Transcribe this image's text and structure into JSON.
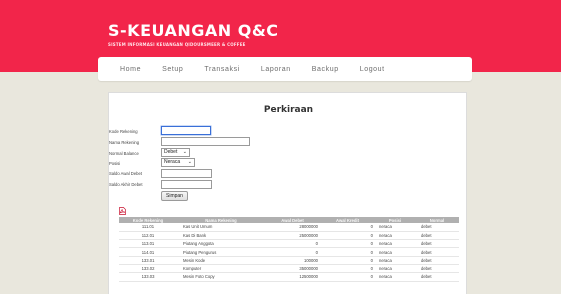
{
  "header": {
    "title": "S-KEUANGAN Q&C",
    "subtitle": "SISTEM INFORMASI KEUANGAN QIDOURSMEER & COFFEE",
    "accent_color": "#f2254a"
  },
  "nav": {
    "items": [
      "Home",
      "Setup",
      "Transaksi",
      "Laporan",
      "Backup",
      "Logout"
    ]
  },
  "page": {
    "title": "Perkiraan"
  },
  "form": {
    "kode_label": "Kode Rekening",
    "kode_value": "",
    "nama_label": "Nama Rekening",
    "nama_value": "",
    "normal_label": "Normal Balance",
    "normal_value": "Debet",
    "posisi_label": "Posisi",
    "posisi_value": "Neraca",
    "saldo_awal_label": "Saldo Awal Debet",
    "saldo_awal_value": "",
    "saldo_akhir_label": "Saldo Akhir Debet",
    "saldo_akhir_value": "",
    "submit_label": "Simpan"
  },
  "export": {
    "icon": "pdf-icon"
  },
  "table": {
    "headers": [
      "Kode Rekening",
      "Nama Rekening",
      "Awal Debet",
      "Awal Kredit",
      "Posisi",
      "Normal"
    ],
    "rows": [
      {
        "kode": "111.01",
        "nama": "Kas Unit Umum",
        "awal_debet": "28000000",
        "awal_kredit": "0",
        "posisi": "neraca",
        "normal": "debet"
      },
      {
        "kode": "112.01",
        "nama": "Kas Di Bank",
        "awal_debet": "25000000",
        "awal_kredit": "0",
        "posisi": "neraca",
        "normal": "debet"
      },
      {
        "kode": "113.01",
        "nama": "Piutang Anggota",
        "awal_debet": "0",
        "awal_kredit": "0",
        "posisi": "neraca",
        "normal": "debet"
      },
      {
        "kode": "114.01",
        "nama": "Piutang Pengurus",
        "awal_debet": "0",
        "awal_kredit": "0",
        "posisi": "neraca",
        "normal": "debet"
      },
      {
        "kode": "133.01",
        "nama": "Mesin Kode",
        "awal_debet": "100000",
        "awal_kredit": "0",
        "posisi": "neraca",
        "normal": "debet"
      },
      {
        "kode": "133.02",
        "nama": "Komputer",
        "awal_debet": "35000000",
        "awal_kredit": "0",
        "posisi": "neraca",
        "normal": "debet"
      },
      {
        "kode": "133.03",
        "nama": "Mesin Foto Copy",
        "awal_debet": "12500000",
        "awal_kredit": "0",
        "posisi": "neraca",
        "normal": "debet"
      }
    ]
  }
}
